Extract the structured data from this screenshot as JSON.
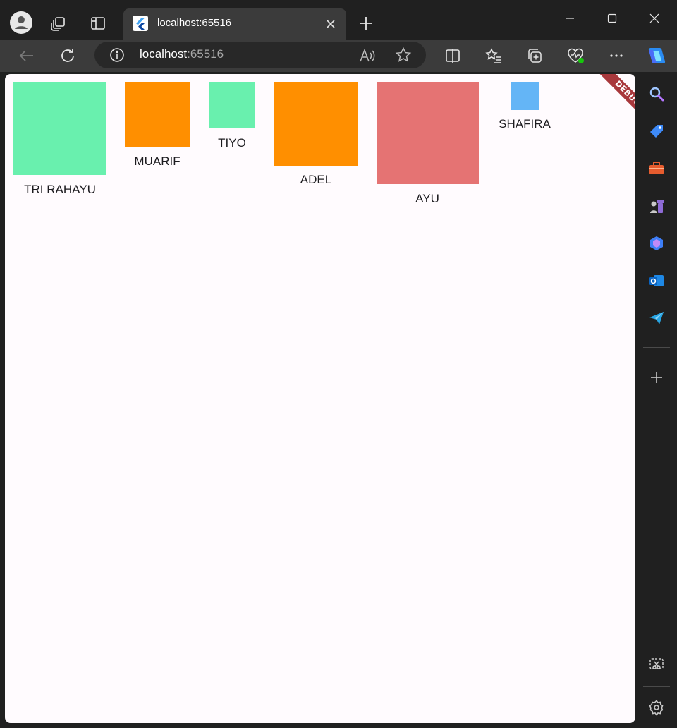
{
  "browser": {
    "tab": {
      "title": "localhost:65516"
    },
    "address": {
      "host": "localhost",
      "port": ":65516"
    }
  },
  "page": {
    "debug_banner": "DEBUG",
    "items": [
      {
        "name": "TRI RAHAYU",
        "color": "#69f0ae"
      },
      {
        "name": "MUARIF",
        "color": "#ff8f00"
      },
      {
        "name": "TIYO",
        "color": "#69f0ae"
      },
      {
        "name": "ADEL",
        "color": "#ff8f00"
      },
      {
        "name": "AYU",
        "color": "#e57373"
      },
      {
        "name": "SHAFIRA",
        "color": "#64b5f6"
      }
    ]
  },
  "icons": {
    "titlebar": [
      "profile-icon",
      "workspaces-icon",
      "tab-actions-icon",
      "close-icon",
      "new-tab-icon",
      "minimize-icon",
      "maximize-icon",
      "window-close-icon"
    ],
    "toolbar": [
      "back-icon",
      "refresh-icon",
      "info-icon",
      "read-aloud-icon",
      "favorite-star-icon",
      "split-screen-icon",
      "favorites-icon",
      "collections-icon",
      "browser-essentials-icon",
      "more-icon",
      "copilot-icon"
    ],
    "sidebar": [
      "search-icon",
      "shopping-icon",
      "tools-icon",
      "games-icon",
      "copilot-sidebar-icon",
      "outlook-icon",
      "send-icon",
      "add-icon",
      "screenshot-icon",
      "settings-icon"
    ]
  }
}
